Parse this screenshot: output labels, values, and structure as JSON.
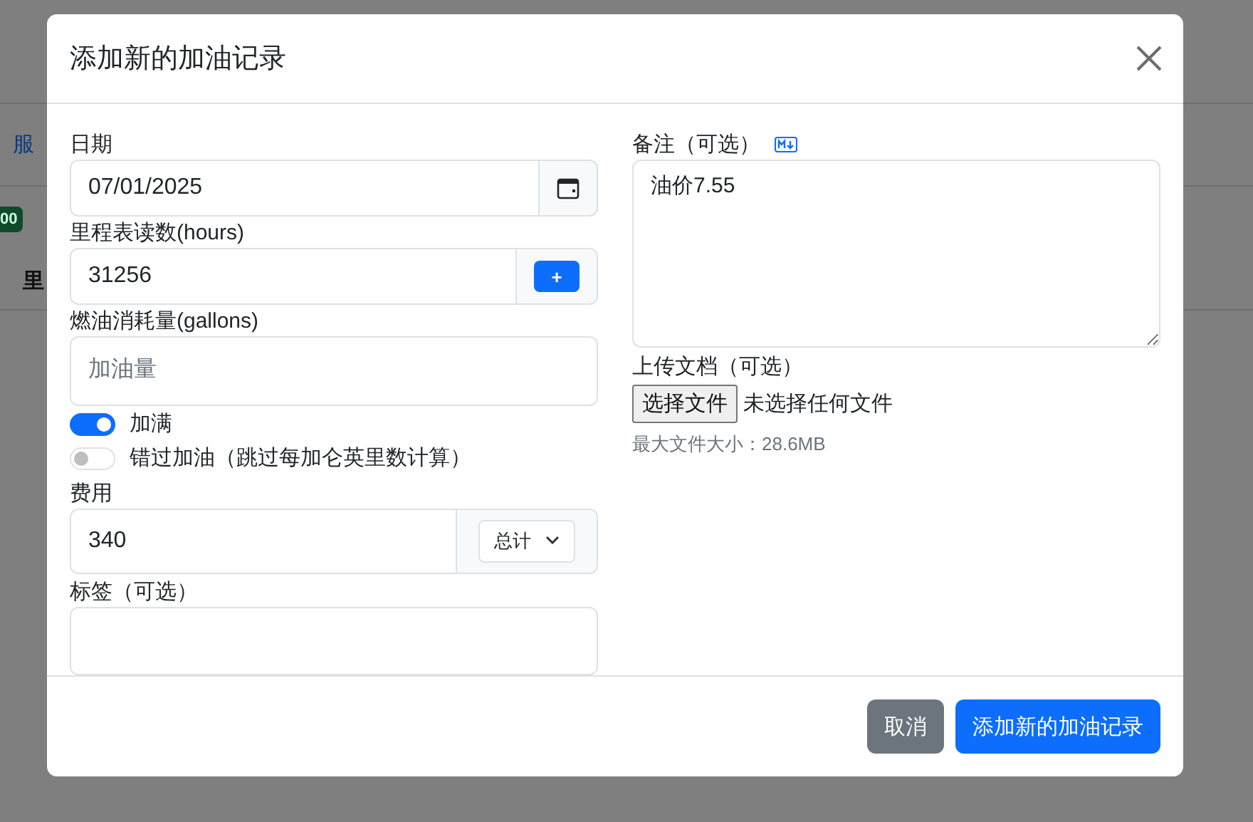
{
  "background": {
    "link": "服",
    "badge": "00",
    "column_1": "里"
  },
  "dialog": {
    "title": "添加新的加油记录"
  },
  "date": {
    "label": "日期",
    "value": "07/01/2025"
  },
  "odometer": {
    "label": "里程表读数(hours)",
    "value": "31256",
    "button": "+"
  },
  "fuel": {
    "label": "燃油消耗量(gallons)",
    "placeholder": "加油量"
  },
  "toggles": [
    {
      "label": "加满",
      "on": true
    },
    {
      "label": "错过加油（跳过每加仑英里数计算）",
      "on": false
    }
  ],
  "cost": {
    "label": "费用",
    "value": "340",
    "unit": "总计"
  },
  "tags": {
    "label": "标签（可选）"
  },
  "notes": {
    "label": "备注（可选）",
    "value": "油价7.55"
  },
  "upload": {
    "label": "上传文档（可选）",
    "button": "选择文件",
    "status": "未选择任何文件",
    "hint": "最大文件大小：28.6MB"
  },
  "buttons": [
    {
      "label": "取消",
      "kind": "secondary"
    },
    {
      "label": "添加新的加油记录",
      "kind": "primary"
    }
  ]
}
